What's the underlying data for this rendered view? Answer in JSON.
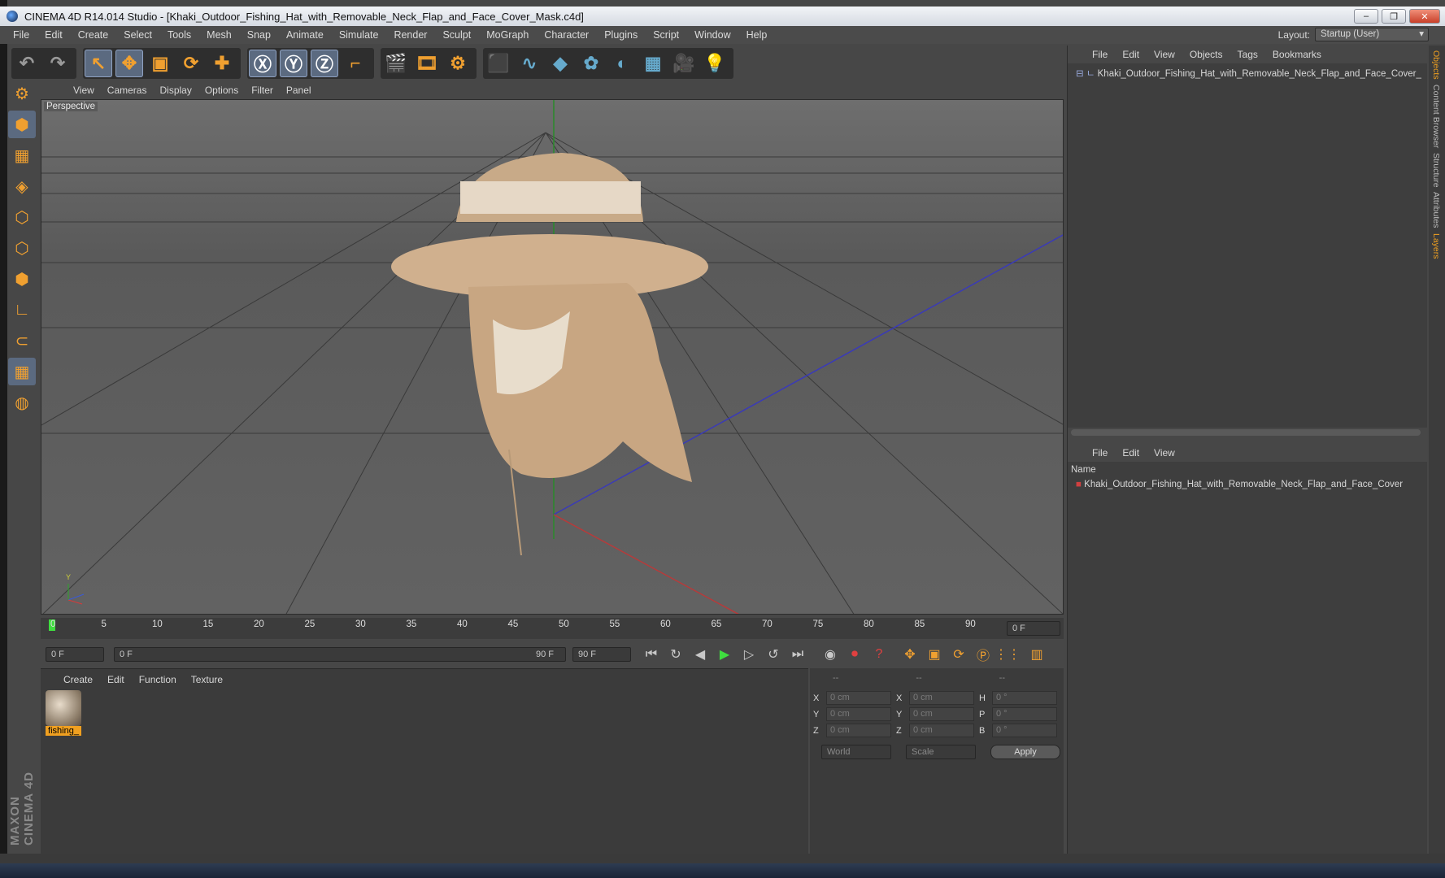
{
  "window": {
    "title": "CINEMA 4D R14.014 Studio - [Khaki_Outdoor_Fishing_Hat_with_Removable_Neck_Flap_and_Face_Cover_Mask.c4d]",
    "min": "–",
    "max": "❐",
    "close": "✕"
  },
  "menu": [
    "File",
    "Edit",
    "Create",
    "Select",
    "Tools",
    "Mesh",
    "Snap",
    "Animate",
    "Simulate",
    "Render",
    "Sculpt",
    "MoGraph",
    "Character",
    "Plugins",
    "Script",
    "Window",
    "Help"
  ],
  "layout": {
    "label": "Layout:",
    "value": "Startup (User)"
  },
  "toolbar": {
    "icons": [
      "undo-icon",
      "redo-icon",
      "live-select-icon",
      "move-icon",
      "scale-icon",
      "rotate-icon",
      "add-icon",
      "x-axis-icon",
      "y-axis-icon",
      "z-axis-icon",
      "world-coord-icon",
      "render-view-icon",
      "render-picture-viewer-icon",
      "edit-render-settings-icon",
      "cube-icon",
      "spline-icon",
      "nurbs-icon",
      "array-icon",
      "deformer-icon",
      "floor-icon",
      "camera-icon",
      "light-icon"
    ],
    "glyphs": [
      "↶",
      "↷",
      "↖",
      "✥",
      "▣",
      "⟳",
      "✚",
      "Ⓧ",
      "Ⓨ",
      "Ⓩ",
      "⌐",
      "🎬",
      "🎞",
      "⚙",
      "⬛",
      "∿",
      "◆",
      "✿",
      "◐",
      "▦",
      "🎥",
      "💡"
    ]
  },
  "viewport": {
    "menu": [
      "View",
      "Cameras",
      "Display",
      "Options",
      "Filter",
      "Panel"
    ],
    "label": "Perspective",
    "axis": {
      "y": "Y",
      "z": "Z",
      "x": "X"
    }
  },
  "timeline": {
    "ticks": [
      "0",
      "5",
      "10",
      "15",
      "20",
      "25",
      "30",
      "35",
      "40",
      "45",
      "50",
      "55",
      "60",
      "65",
      "70",
      "75",
      "80",
      "85",
      "90"
    ],
    "frame_field": "0 F"
  },
  "transport": {
    "start": "0 F",
    "range_start": "0 F",
    "range_end": "90 F",
    "end": "90 F"
  },
  "materials": {
    "menu": [
      "Create",
      "Edit",
      "Function",
      "Texture"
    ],
    "items": [
      {
        "name": "fishing_"
      }
    ]
  },
  "coords": {
    "headers": [
      "--",
      "--",
      "--"
    ],
    "rows": [
      {
        "a": "X",
        "v1": "0 cm",
        "b": "X",
        "v2": "0 cm",
        "c": "H",
        "v3": "0 °"
      },
      {
        "a": "Y",
        "v1": "0 cm",
        "b": "Y",
        "v2": "0 cm",
        "c": "P",
        "v3": "0 °"
      },
      {
        "a": "Z",
        "v1": "0 cm",
        "b": "Z",
        "v2": "0 cm",
        "c": "B",
        "v3": "0 °"
      }
    ],
    "mode1": "World",
    "mode2": "Scale",
    "apply": "Apply"
  },
  "objects": {
    "menu": [
      "File",
      "Edit",
      "View",
      "Objects",
      "Tags",
      "Bookmarks"
    ],
    "items": [
      "Khaki_Outdoor_Fishing_Hat_with_Removable_Neck_Flap_and_Face_Cover_"
    ]
  },
  "layers": {
    "menu": [
      "File",
      "Edit",
      "View"
    ],
    "header": "Name",
    "items": [
      "Khaki_Outdoor_Fishing_Hat_with_Removable_Neck_Flap_and_Face_Cover"
    ]
  },
  "sidetabs": [
    "Objects",
    "Content Browser",
    "Structure",
    "Attributes",
    "Layers"
  ],
  "brand": "MAXON CINEMA 4D"
}
